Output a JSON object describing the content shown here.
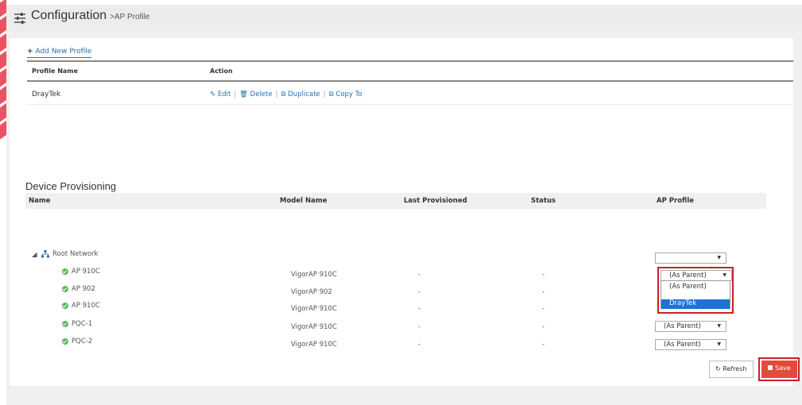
{
  "header": {
    "title": "Configuration",
    "breadcrumb": ">AP Profile",
    "icon": "sliders-icon"
  },
  "profiles": {
    "add_label": "Add New Profile",
    "columns": [
      "Profile Name",
      "Action"
    ],
    "rows": [
      {
        "name": "DrayTek",
        "actions": [
          "Edit",
          "Delete",
          "Duplicate",
          "Copy To"
        ]
      }
    ]
  },
  "provisioning": {
    "title": "Device Provisioning",
    "columns": [
      "Name",
      "Model Name",
      "Last Provisioned",
      "Status",
      "AP Profile"
    ],
    "root": {
      "name": "Root Network",
      "profile": ""
    },
    "devices": [
      {
        "name": "AP 910C",
        "model": "VigorAP 910C",
        "last": "-",
        "status": "-",
        "profile": "(As Parent)"
      },
      {
        "name": "AP 902",
        "model": "VigorAP 902",
        "last": "-",
        "status": "-",
        "profile": "(As Parent)"
      },
      {
        "name": "AP 910C",
        "model": "VigorAP 910C",
        "last": "-",
        "status": "-",
        "profile": "(As Parent)"
      },
      {
        "name": "PQC-1",
        "model": "VigorAP 910C",
        "last": "-",
        "status": "-",
        "profile": "(As Parent)"
      },
      {
        "name": "PQC-2",
        "model": "VigorAP 910C",
        "last": "-",
        "status": "-",
        "profile": "(As Parent)"
      }
    ],
    "dropdown_options": [
      "(As Parent)",
      "DrayTek"
    ],
    "dropdown_selected": "DrayTek"
  },
  "buttons": {
    "refresh": "Refresh",
    "save": "Save"
  },
  "colors": {
    "accent": "#e24b3c",
    "link": "#2a6fb0",
    "highlight": "#cc1f2a",
    "status_ok": "#5cb85c",
    "selection": "#1e73d2"
  }
}
